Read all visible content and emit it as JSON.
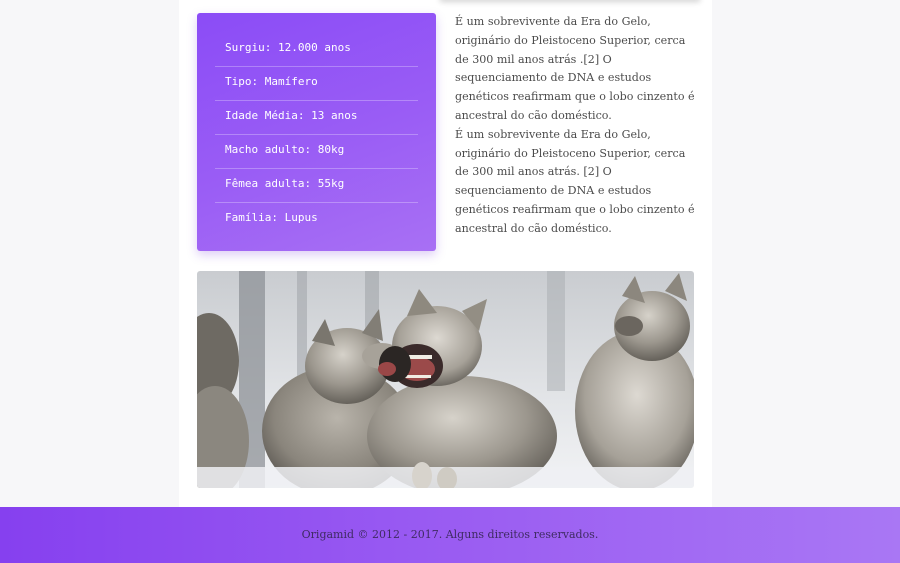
{
  "facts": {
    "items": [
      "Surgiu: 12.000 anos",
      "Tipo: Mamífero",
      "Idade Média: 13 anos",
      "Macho adulto: 80kg",
      "Fêmea adulta: 55kg",
      "Família: Lupus"
    ]
  },
  "description": {
    "paragraph_1": "É um sobrevivente da Era do Gelo, originário do Pleistoceno Superior, cerca de 300 mil anos atrás .[2] O sequenciamento de DNA e estudos genéticos reafirmam que o lobo cinzento é ancestral do cão doméstico.",
    "paragraph_2": "É um sobrevivente da Era do Gelo, originário do Pleistoceno Superior, cerca de 300 mil anos atrás. [2] O sequenciamento de DNA e estudos genéticos reafirmam que o lobo cinzento é ancestral do cão doméstico."
  },
  "footer": {
    "text": "Origamid © 2012 - 2017. Alguns direitos reservados."
  },
  "colors": {
    "accent": "#8b4cf6",
    "accent_light": "#a977f4",
    "text": "#4b4b4b",
    "footer_text": "#3f2b63"
  }
}
